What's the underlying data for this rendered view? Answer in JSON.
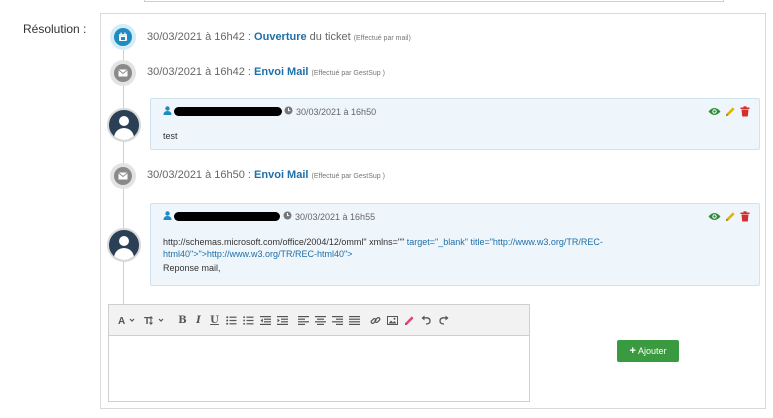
{
  "form": {
    "resolution_label": "Résolution :"
  },
  "timeline": {
    "events": [
      {
        "date": "30/03/2021 à 16h42 :",
        "action": "Ouverture",
        "rest": " du ticket",
        "by": "(Effectué par mail)",
        "icon": "calendar-icon"
      },
      {
        "date": "30/03/2021 à 16h42 :",
        "action": "Envoi Mail",
        "rest": "",
        "by": "(Effectué par GestSup )",
        "icon": "envelope-icon"
      },
      {
        "date": "30/03/2021 à 16h50 :",
        "action": "Envoi Mail",
        "rest": "",
        "by": "(Effectué par GestSup )",
        "icon": "envelope-icon"
      }
    ],
    "comments": [
      {
        "date": "30/03/2021 à 16h50",
        "lines": [
          "test"
        ]
      },
      {
        "date": "30/03/2021 à 16h55",
        "line1_plain": "http://schemas.microsoft.com/office/2004/12/omml\" xmlns=\"\"",
        "line1_link": " target=\"_blank\" title=\"http://www.w3.org/TR/REC-",
        "line2_link": "html40\">\"",
        "line2_link2": ">http://www.w3.org/TR/REC-html40\">",
        "line3": "Reponse mail,"
      }
    ]
  },
  "editor": {
    "toolbar_icons": [
      "font-icon",
      "text-height-icon",
      "bold-icon",
      "italic-icon",
      "underline-icon",
      "bullet-list-icon",
      "numbered-list-icon",
      "outdent-icon",
      "indent-icon",
      "align-left-icon",
      "align-center-icon",
      "align-right-icon",
      "justify-icon",
      "link-icon",
      "image-icon",
      "eraser-icon",
      "undo-icon",
      "redo-icon"
    ],
    "bold": "B",
    "italic": "I",
    "underline": "U"
  },
  "buttons": {
    "add_label": "Ajouter"
  },
  "colors": {
    "accent_blue": "#1f6fa8",
    "add_green": "#3a9a3f",
    "eye_green": "#2e8b3a",
    "pencil_yellow": "#e0b400",
    "trash_red": "#d32f2f"
  }
}
